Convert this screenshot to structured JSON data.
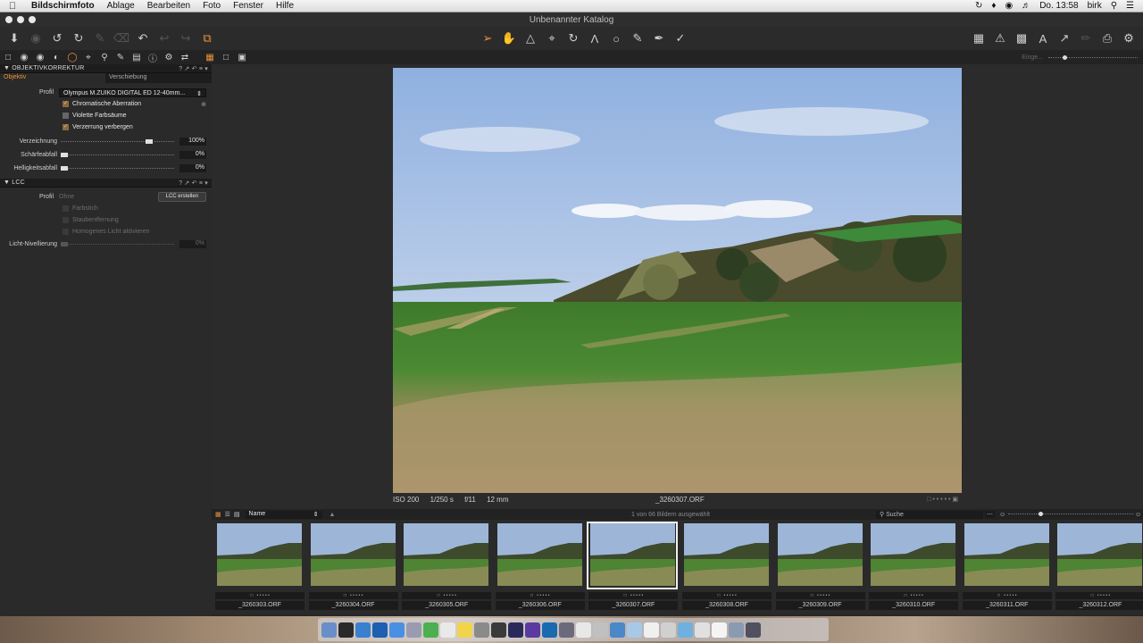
{
  "menubar": {
    "app": "Bildschirmfoto",
    "items": [
      "Ablage",
      "Bearbeiten",
      "Foto",
      "Fenster",
      "Hilfe"
    ],
    "clock": "Do. 13:58",
    "user": "birk"
  },
  "window": {
    "title": "Unbenannter Katalog"
  },
  "panel": {
    "objektiv": {
      "title": "OBJEKTIVKORREKTUR",
      "tab_active": "Objektiv",
      "tab_other": "Verschiebung",
      "profil_label": "Profil",
      "profil_value": "Olympus M.ZUIKO DIGITAL ED 12-40mm...",
      "checks": [
        {
          "label": "Chromatische Aberration",
          "checked": true
        },
        {
          "label": "Violette Farbsäume",
          "checked": false
        },
        {
          "label": "Verzerrung verbergen",
          "checked": true
        }
      ],
      "sliders": [
        {
          "label": "Verzeichnung",
          "value": "100%",
          "level": 1.0
        },
        {
          "label": "Schärfeabfall",
          "value": "0%",
          "level": 0.0
        },
        {
          "label": "Helligkeitsabfall",
          "value": "0%",
          "level": 0.0
        }
      ]
    },
    "lcc": {
      "title": "LCC",
      "profil_label": "Profil",
      "profil_value": "Ohne",
      "button": "LCC erstellen",
      "checks": [
        "Farbstich",
        "Staubentfernung",
        "Homogenes Licht aktivieren"
      ],
      "slider_label": "Licht-Nivellierung",
      "slider_value": "0%"
    }
  },
  "viewer": {
    "iso": "ISO 200",
    "shutter": "1/250 s",
    "aperture": "f/11",
    "focal": "12 mm",
    "filename": "_3260307.ORF"
  },
  "browser": {
    "sort": "Name",
    "status": "1 von 66 Bildern ausgewählt",
    "search_placeholder": "Suche",
    "thumbs": [
      "_3260303.ORF",
      "_3260304.ORF",
      "_3260305.ORF",
      "_3260306.ORF",
      "_3260307.ORF",
      "_3260308.ORF",
      "_3260309.ORF",
      "_3260310.ORF",
      "_3260311.ORF",
      "_3260312.ORF"
    ],
    "selected_index": 4
  },
  "top_right_label": "Einge..."
}
